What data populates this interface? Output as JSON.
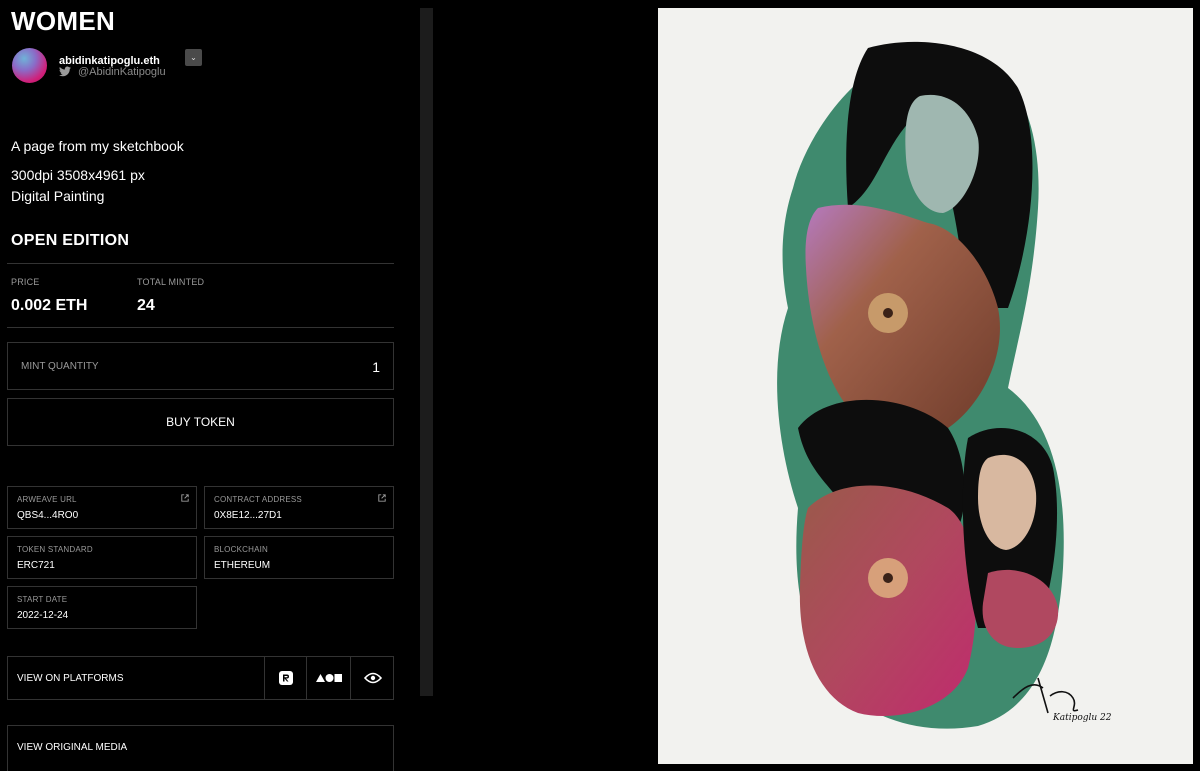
{
  "title": "WOMEN",
  "artist": {
    "name": "abidinkatipoglu.eth",
    "twitter_handle": "@AbidinKatipoglu"
  },
  "description": {
    "line1": "A page from my sketchbook",
    "line2": "300dpi 3508x4961 px",
    "line3": "Digital Painting"
  },
  "edition": {
    "title": "OPEN EDITION",
    "price_label": "PRICE",
    "price_value": "0.002 ETH",
    "minted_label": "TOTAL MINTED",
    "minted_value": "24"
  },
  "mint": {
    "label": "MINT QUANTITY",
    "quantity": "1",
    "buy_label": "BUY TOKEN"
  },
  "details": {
    "arweave_label": "ARWEAVE URL",
    "arweave_value": "QBS4...4RO0",
    "contract_label": "CONTRACT ADDRESS",
    "contract_value": "0X8E12...27D1",
    "standard_label": "TOKEN STANDARD",
    "standard_value": "ERC721",
    "chain_label": "BLOCKCHAIN",
    "chain_value": "ETHEREUM",
    "start_label": "START DATE",
    "start_value": "2022-12-24"
  },
  "platforms": {
    "label": "VIEW ON PLATFORMS"
  },
  "original_media": {
    "label": "VIEW ORIGINAL MEDIA"
  },
  "signature": "Katipoglu 22",
  "colors": {
    "background": "#000000",
    "border": "#333333",
    "muted_text": "#9a9a9a",
    "artwork_paper": "#f2f2ef",
    "artwork_teal": "#3f8a6e",
    "artwork_skin": "#a0614a",
    "artwork_magenta": "#b2286a"
  }
}
